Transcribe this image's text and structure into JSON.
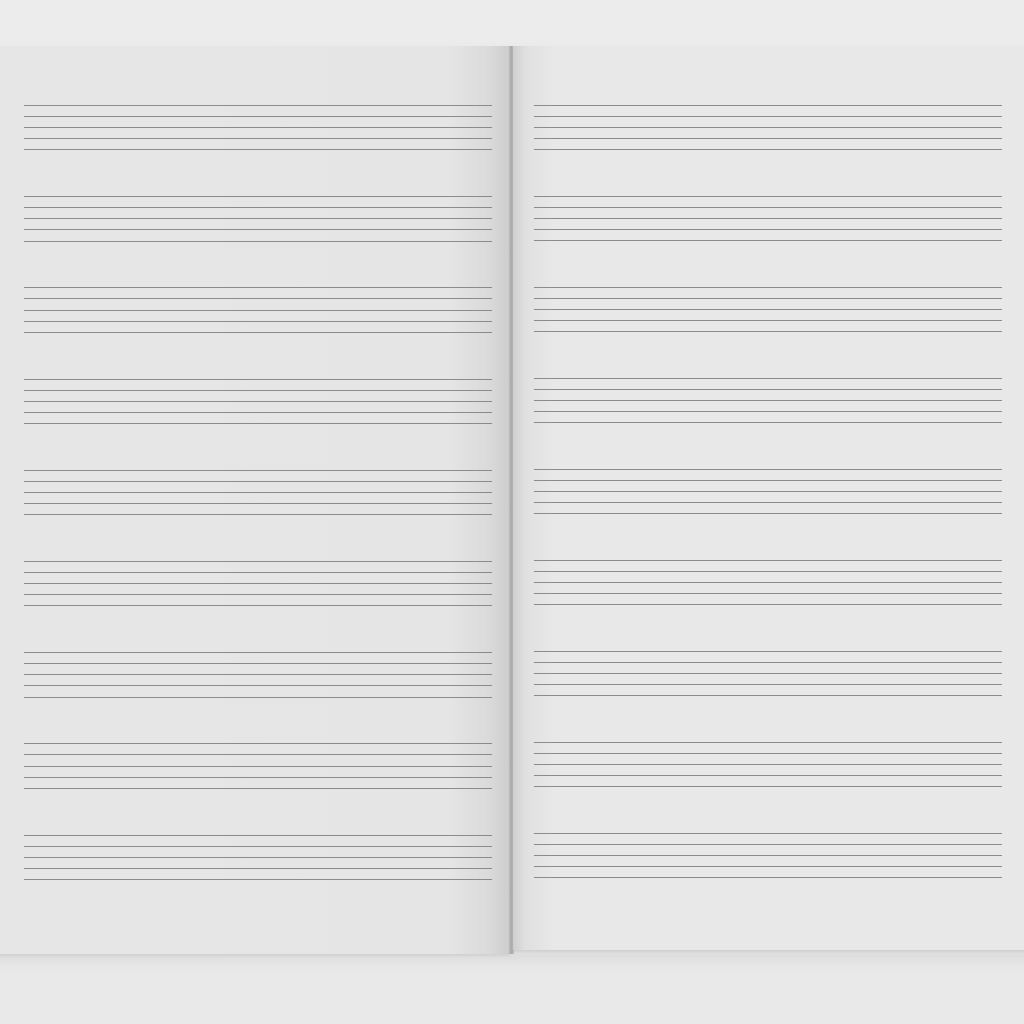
{
  "scene": {
    "subject": "open-blank-music-manuscript-notebook",
    "pages": [
      {
        "side": "left",
        "staff_count": 9,
        "lines_per_staff": 5
      },
      {
        "side": "right",
        "staff_count": 9,
        "lines_per_staff": 5
      }
    ],
    "colors": {
      "background": "#ebebeb",
      "paper": "#e7e7e7",
      "staff_line": "#8b8b8b",
      "gutter": "#a9a9a9"
    }
  }
}
